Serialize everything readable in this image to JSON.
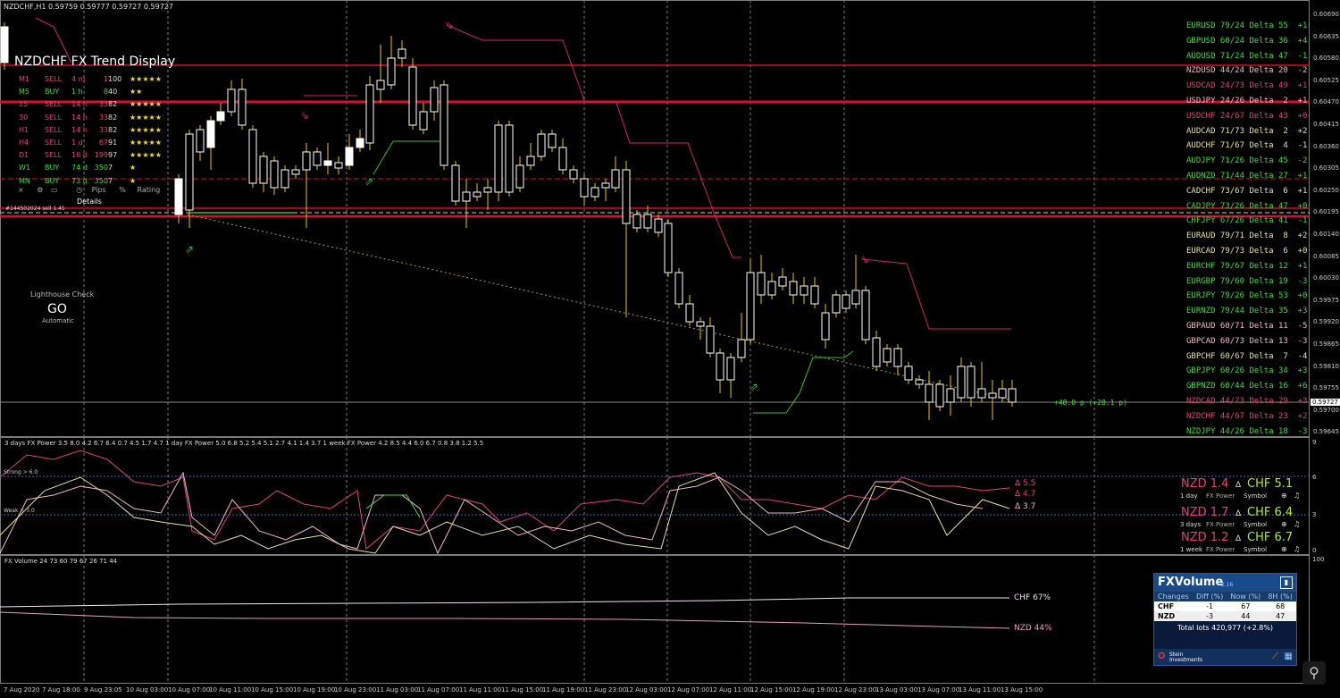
{
  "title_bar": {
    "symbol_info": "NZDCHF,H1  0.59759 0.59777 0.59727 0.59727"
  },
  "trend_display": {
    "title": "NZDCHF FX Trend Display",
    "rows": [
      {
        "tf": "M1",
        "dir": "SELL",
        "age": "4 m",
        "pips": "1",
        "pct": "100",
        "stars": "★★★★★",
        "color": "#e0407a"
      },
      {
        "tf": "M5",
        "dir": "BUY",
        "age": "1 h",
        "pips": "8",
        "pct": "40",
        "stars": "★★",
        "color": "#3ddc3d"
      },
      {
        "tf": "15",
        "dir": "SELL",
        "age": "14 h",
        "pips": "33",
        "pct": "82",
        "stars": "★★★★★",
        "color": "#e0407a"
      },
      {
        "tf": "30",
        "dir": "SELL",
        "age": "14 h",
        "pips": "33",
        "pct": "82",
        "stars": "★★★★★",
        "color": "#e0407a"
      },
      {
        "tf": "H1",
        "dir": "SELL",
        "age": "14 h",
        "pips": "33",
        "pct": "82",
        "stars": "★★★★★",
        "color": "#e0407a"
      },
      {
        "tf": "H4",
        "dir": "SELL",
        "age": "1 d",
        "pips": "67",
        "pct": "91",
        "stars": "★★★★★",
        "color": "#e0407a"
      },
      {
        "tf": "D1",
        "dir": "SELL",
        "age": "16 d",
        "pips": "199",
        "pct": "97",
        "stars": "★★★★★",
        "color": "#e0407a"
      },
      {
        "tf": "W1",
        "dir": "BUY",
        "age": "74 d",
        "pips": "350",
        "pct": "7",
        "stars": "★",
        "color": "#3ddc3d"
      },
      {
        "tf": "MN",
        "dir": "BUY",
        "age": "73 d",
        "pips": "350",
        "pct": "7",
        "stars": "★",
        "color": "#3ddc3d"
      }
    ],
    "footer": {
      "x": "×",
      "pips": "Pips",
      "pct": "%",
      "rating": "Rating"
    },
    "details": "Details",
    "trade_label": "#144502024 sell 1.45"
  },
  "lighthouse": {
    "label": "Lighthouse Check",
    "status": "GO",
    "mode": "Automatic"
  },
  "price_axis": [
    "0.60690",
    "0.60635",
    "0.60580",
    "0.60525",
    "0.60470",
    "0.60415",
    "0.60360",
    "0.60305",
    "0.60250",
    "0.60195",
    "0.60140",
    "0.60085",
    "0.60030",
    "0.59975",
    "0.59920",
    "0.59865",
    "0.59810",
    "0.59755",
    "0.59700",
    "0.59645"
  ],
  "current_price": "0.59727",
  "profit_label": "+48.0 p (+28.1 p)",
  "deltas": [
    {
      "text": "EURUSD 79/24 Delta 55  +1",
      "color": "#3ddc3d"
    },
    {
      "text": "GBPUSD 60/24 Delta 36  +4",
      "color": "#3ddc3d"
    },
    {
      "text": "AUDUSD 71/24 Delta 47  -1",
      "color": "#3ddc3d"
    },
    {
      "text": "NZDUSD 44/24 Delta 20  -2",
      "color": "#f0b8c8"
    },
    {
      "text": "USDCAD 24/73 Delta 49  +1",
      "color": "#e0407a"
    },
    {
      "text": "USDJPY 24/26 Delta  2  +1",
      "color": "#f0b8c8"
    },
    {
      "text": "USDCHF 24/67 Delta 43  +0",
      "color": "#e0407a"
    },
    {
      "text": "AUDCAD 71/73 Delta  2  +2",
      "color": "#e8e0a0"
    },
    {
      "text": "AUDCHF 71/67 Delta  4  -1",
      "color": "#e8e0a0"
    },
    {
      "text": "AUDJPY 71/26 Delta 45  -2",
      "color": "#3ddc3d"
    },
    {
      "text": "AUDNZD 71/44 Delta 27  +1",
      "color": "#3ddc3d"
    },
    {
      "text": "CADCHF 73/67 Delta  6  +1",
      "color": "#e8e0a0"
    },
    {
      "text": "CADJPY 73/26 Delta 47  +0",
      "color": "#3ddc3d"
    },
    {
      "text": "CHFJPY 67/26 Delta 41  -1",
      "color": "#3ddc3d"
    },
    {
      "text": "EURAUD 79/71 Delta  8  +2",
      "color": "#e8e0a0"
    },
    {
      "text": "EURCAD 79/73 Delta  6  +0",
      "color": "#e8e0a0"
    },
    {
      "text": "EURCHF 79/67 Delta 12  +1",
      "color": "#3ddc3d"
    },
    {
      "text": "EURGBP 79/60 Delta 19  -3",
      "color": "#3ddc3d"
    },
    {
      "text": "EURJPY 79/26 Delta 53  +0",
      "color": "#3ddc3d"
    },
    {
      "text": "EURNZD 79/44 Delta 35  +3",
      "color": "#3ddc3d"
    },
    {
      "text": "GBPAUD 60/71 Delta 11  -5",
      "color": "#f0b8c8"
    },
    {
      "text": "GBPCAD 60/73 Delta 13  -3",
      "color": "#f0b8c8"
    },
    {
      "text": "GBPCHF 60/67 Delta  7  -4",
      "color": "#e8e0a0"
    },
    {
      "text": "GBPJPY 60/26 Delta 34  +3",
      "color": "#3ddc3d"
    },
    {
      "text": "GBPNZD 60/44 Delta 16  +6",
      "color": "#3ddc3d"
    },
    {
      "text": "NZDCAD 44/73 Delta 29  +3",
      "color": "#e0407a"
    },
    {
      "text": "NZDCHF 44/67 Delta 23  +2",
      "color": "#e0407a"
    },
    {
      "text": "NZDJPY 44/26 Delta 18  -3",
      "color": "#3ddc3d"
    }
  ],
  "power_panel": {
    "header": "3 days FX Power 3.5 8.0 4.2 6.7 6.4 0.7 4.5 1.7 4.7    1 day FX Power 5.0 6.8 5.2 5.4 5.1 2.7 4.1 1.4 3.7    1 week FX Power 4.2 8.5 4.4 6.0 6.7 0.8 3.8 1.2 5.5",
    "strong": "Strong > 6.0",
    "weak": "Weak < 3.0",
    "axis": [
      "9",
      "6",
      "3",
      "0"
    ],
    "deltas": [
      "Δ 5.5",
      "Δ 4.7",
      "Δ 3.7"
    ],
    "blocks": [
      {
        "nzd": "NZD 1.4",
        "chf": "CHF 5.1",
        "period": "1 day",
        "power": "FX Power",
        "symbol": "Symbol"
      },
      {
        "nzd": "NZD 1.7",
        "chf": "CHF 6.4",
        "period": "3 days",
        "power": "FX Power",
        "symbol": "Symbol"
      },
      {
        "nzd": "NZD 1.2",
        "chf": "CHF 6.7",
        "period": "1 week",
        "power": "FX Power",
        "symbol": "Symbol"
      }
    ]
  },
  "volume_panel": {
    "header": "FX Volume 24 73 60 79 67 26 71 44",
    "axis": [
      "100",
      "0"
    ],
    "chf_label": "CHF 67%",
    "nzd_label": "NZD 44%",
    "widget": {
      "title": "FXVolume",
      "version": "2.16",
      "cols": [
        "Changes",
        "Diff (%)",
        "Now (%)",
        "8H (%)"
      ],
      "rows": [
        [
          "CHF",
          "-1",
          "67",
          "68"
        ],
        [
          "NZD",
          "-3",
          "44",
          "47"
        ]
      ],
      "total": "Total lots 420,977 (+2.8%)",
      "brand": "Stein Investments"
    }
  },
  "time_axis": [
    "7 Aug 2020",
    "7 Aug 18:00",
    "9 Aug 23:05",
    "10 Aug 03:00",
    "10 Aug 07:00",
    "10 Aug 11:00",
    "10 Aug 15:00",
    "10 Aug 19:00",
    "10 Aug 23:00",
    "11 Aug 03:00",
    "11 Aug 07:00",
    "11 Aug 11:00",
    "11 Aug 15:00",
    "11 Aug 19:00",
    "11 Aug 23:00",
    "12 Aug 03:00",
    "12 Aug 07:00",
    "12 Aug 11:00",
    "12 Aug 15:00",
    "12 Aug 19:00",
    "12 Aug 23:00",
    "13 Aug 03:00",
    "13 Aug 07:00",
    "13 Aug 11:00",
    "13 Aug 15:00"
  ],
  "colors": {
    "bull": "#ffffff",
    "bear": "#ffffff",
    "wick": "#e8c800",
    "red_line": "#d01030",
    "magenta": "#d0206a",
    "green": "#30c030"
  }
}
